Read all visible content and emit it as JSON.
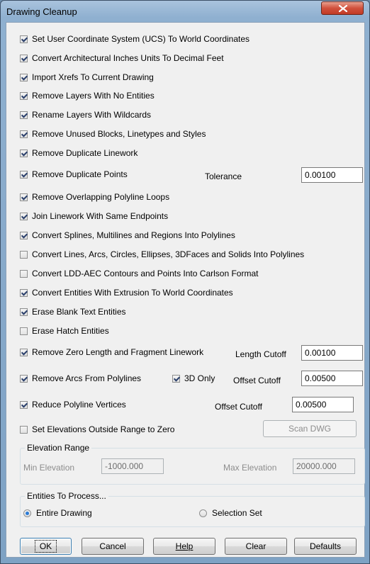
{
  "window": {
    "title": "Drawing Cleanup",
    "close_label": "X"
  },
  "options": [
    {
      "label": "Set User Coordinate System (UCS) To World Coordinates",
      "checked": true
    },
    {
      "label": "Convert Architectural Inches Units To Decimal Feet",
      "checked": true
    },
    {
      "label": "Import Xrefs To Current Drawing",
      "checked": true
    },
    {
      "label": "Remove Layers With No Entities",
      "checked": true
    },
    {
      "label": "Rename Layers With Wildcards",
      "checked": true
    },
    {
      "label": "Remove Unused Blocks, Linetypes and Styles",
      "checked": true
    },
    {
      "label": "Remove Duplicate Linework",
      "checked": true
    },
    {
      "label": "Remove Duplicate Points",
      "checked": true
    },
    {
      "label": "Remove Overlapping Polyline Loops",
      "checked": true
    },
    {
      "label": "Join Linework With Same Endpoints",
      "checked": true
    },
    {
      "label": "Convert Splines, Multilines and Regions Into Polylines",
      "checked": true
    },
    {
      "label": "Convert Lines, Arcs, Circles, Ellipses, 3DFaces and Solids Into Polylines",
      "checked": false
    },
    {
      "label": "Convert LDD-AEC Contours and Points Into Carlson Format",
      "checked": false
    },
    {
      "label": "Convert Entities With Extrusion To World Coordinates",
      "checked": true
    },
    {
      "label": "Erase Blank Text Entities",
      "checked": true
    },
    {
      "label": "Erase Hatch Entities",
      "checked": false
    },
    {
      "label": "Remove Zero Length and Fragment Linework",
      "checked": true
    },
    {
      "label": "Remove Arcs From Polylines",
      "checked": true
    },
    {
      "label": "Reduce Polyline Vertices",
      "checked": true
    },
    {
      "label": "Set Elevations Outside Range to Zero",
      "checked": false
    }
  ],
  "tolerance": {
    "label": "Tolerance",
    "value": "0.00100"
  },
  "length_cutoff": {
    "label": "Length Cutoff",
    "value": "0.00100"
  },
  "three_d_only": {
    "label": "3D Only",
    "checked": true
  },
  "arcs_offset_cutoff": {
    "label": "Offset Cutoff",
    "value": "0.00500"
  },
  "reduce_offset_cutoff": {
    "label": "Offset Cutoff",
    "value": "0.00500"
  },
  "scan_dwg": {
    "label": "Scan DWG"
  },
  "elevation_range": {
    "title": "Elevation Range",
    "min_label": "Min Elevation",
    "min_value": "-1000.000",
    "max_label": "Max Elevation",
    "max_value": "20000.000"
  },
  "entities": {
    "title": "Entities To Process...",
    "entire_label": "Entire Drawing",
    "entire_selected": true,
    "selection_label": "Selection Set",
    "selection_selected": false
  },
  "buttons": {
    "ok": "OK",
    "cancel": "Cancel",
    "help": "Help",
    "clear": "Clear",
    "defaults": "Defaults"
  },
  "colors": {
    "title_bar": "#8fb0d0",
    "close": "#c13a25",
    "dialog_bg": "#f0f0f0",
    "radio_dot": "#2b7bd6"
  }
}
